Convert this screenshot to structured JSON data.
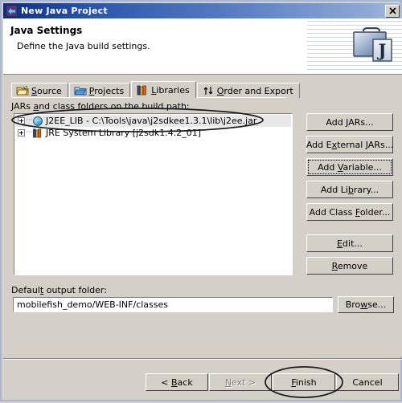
{
  "window": {
    "title": "New Java Project",
    "app_icon": "eclipse-wizard-icon",
    "close_label": "✕"
  },
  "header": {
    "heading": "Java Settings",
    "subheading": "Define the Java build settings.",
    "icon": "java-project-icon",
    "icon_letter": "J"
  },
  "tabs": [
    {
      "label": "Source",
      "mnemonic": "S",
      "icon": "source-folder-icon",
      "selected": false
    },
    {
      "label": "Projects",
      "mnemonic": "P",
      "icon": "projects-folder-icon",
      "selected": false
    },
    {
      "label": "Libraries",
      "mnemonic": "L",
      "icon": "libraries-books-icon",
      "selected": true
    },
    {
      "label": "Order and Export",
      "mnemonic": "O",
      "icon": "order-arrows-icon",
      "selected": false
    }
  ],
  "libraries_panel": {
    "group_label": "JARs and class folders on the build path:",
    "group_label_mnemonic": "a",
    "entries": [
      {
        "text": "J2EE_LIB - C:\\Tools\\java\\j2sdkee1.3.1\\lib\\j2ee.jar",
        "icon": "variable-jar-icon",
        "expander": "plus",
        "selected": true
      },
      {
        "text": "JRE System Library [j2sdk1.4.2_01]",
        "icon": "jre-library-icon",
        "expander": "plus",
        "selected": false
      }
    ],
    "buttons": [
      {
        "label": "Add JARs...",
        "mnemonic": "J",
        "focused": false
      },
      {
        "label": "Add External JARs...",
        "mnemonic": "x",
        "focused": false
      },
      {
        "label": "Add Variable...",
        "mnemonic": "V",
        "focused": true
      },
      {
        "label": "Add Library...",
        "mnemonic": "b",
        "focused": false
      },
      {
        "label": "Add Class Folder...",
        "mnemonic": "F",
        "focused": false
      },
      {
        "label": "Edit...",
        "mnemonic": "E",
        "focused": false
      },
      {
        "label": "Remove",
        "mnemonic": "R",
        "focused": false
      }
    ]
  },
  "output_folder": {
    "label": "Default output folder:",
    "label_mnemonic": "t",
    "value": "mobilefish_demo/WEB-INF/classes",
    "placeholder": "",
    "browse_label": "Browse...",
    "browse_mnemonic": "w"
  },
  "dialog_buttons": [
    {
      "label": "< Back",
      "mnemonic": "B",
      "enabled": true,
      "highlighted": false
    },
    {
      "label": "Next >",
      "mnemonic": "N",
      "enabled": false,
      "highlighted": false
    },
    {
      "label": "Finish",
      "mnemonic": "F",
      "enabled": true,
      "highlighted": true
    },
    {
      "label": "Cancel",
      "mnemonic": "",
      "enabled": true,
      "highlighted": false
    }
  ],
  "annotations": {
    "ellipse_list_entry": "hand-drawn ellipse around first library entry",
    "ellipse_finish": "hand-drawn ellipse around Finish button",
    "color": "#1a1a1a"
  },
  "colors": {
    "titlebar_start": "#0c2f80",
    "titlebar_end": "#aabfe2",
    "window_face": "#d4d0c8",
    "window_border": "#a7b6d4",
    "field_bg": "#ffffff",
    "selection_bg": "#e8e8e8"
  }
}
